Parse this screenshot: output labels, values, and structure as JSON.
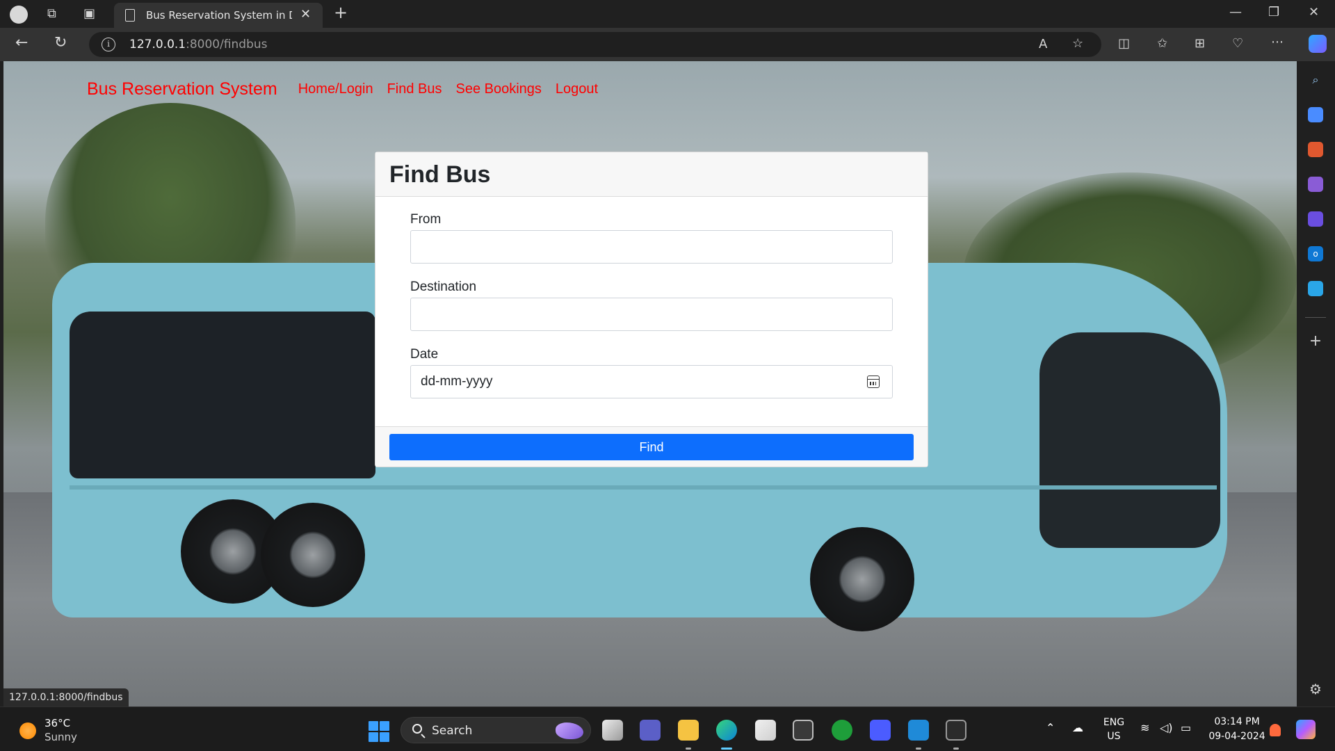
{
  "browser": {
    "tab_title": "Bus Reservation System in Djang",
    "url_host": "127.0.0.1",
    "url_path": ":8000/findbus",
    "status_url": "127.0.0.1:8000/findbus"
  },
  "site": {
    "brand": "Bus Reservation System",
    "nav": [
      {
        "label": "Home/Login"
      },
      {
        "label": "Find Bus"
      },
      {
        "label": "See Bookings"
      },
      {
        "label": "Logout"
      }
    ]
  },
  "form": {
    "title": "Find Bus",
    "from_label": "From",
    "from_value": "",
    "destination_label": "Destination",
    "destination_value": "",
    "date_label": "Date",
    "date_placeholder": "dd-mm-yyyy",
    "submit_label": "Find"
  },
  "taskbar": {
    "weather_temp": "36°C",
    "weather_desc": "Sunny",
    "search_label": "Search",
    "lang": "ENG",
    "region": "US",
    "time": "03:14 PM",
    "date": "09-04-2024"
  },
  "colors": {
    "brand_red": "#ff0000",
    "primary_blue": "#0d6efd"
  }
}
